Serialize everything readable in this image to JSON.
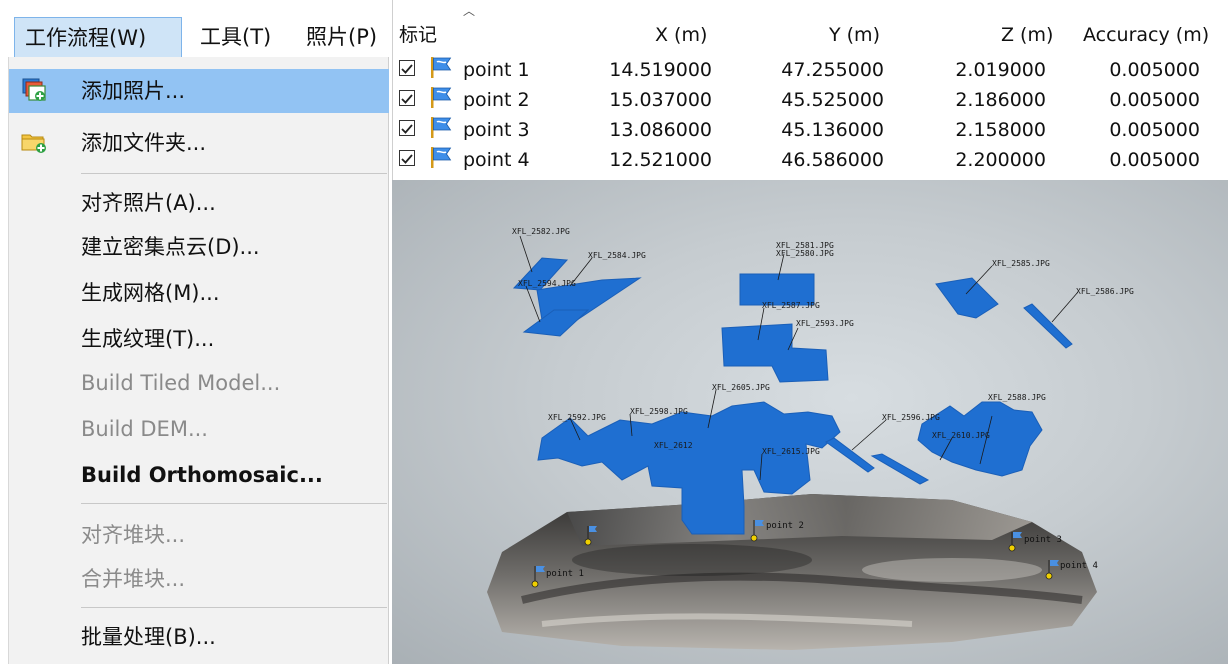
{
  "menubar": {
    "workflow": "工作流程(W)",
    "tools": "工具(T)",
    "photos": "照片(P)"
  },
  "workflow_menu": {
    "add_photos": "添加照片...",
    "add_folder": "添加文件夹...",
    "align_photos": "对齐照片(A)...",
    "build_dense_cloud": "建立密集点云(D)...",
    "build_mesh": "生成网格(M)...",
    "build_texture": "生成纹理(T)...",
    "build_tiled_model": "Build Tiled Model...",
    "build_dem": "Build DEM...",
    "build_orthomosaic": "Build Orthomosaic...",
    "align_chunks": "对齐堆块...",
    "merge_chunks": "合并堆块...",
    "batch_process": "批量处理(B)..."
  },
  "markers_table": {
    "columns": [
      "标记",
      "X (m)",
      "Y (m)",
      "Z (m)",
      "Accuracy (m)"
    ],
    "rows": [
      {
        "name": "point 1",
        "x": "14.519000",
        "y": "47.255000",
        "z": "2.019000",
        "accuracy": "0.005000"
      },
      {
        "name": "point 2",
        "x": "15.037000",
        "y": "45.525000",
        "z": "2.186000",
        "accuracy": "0.005000"
      },
      {
        "name": "point 3",
        "x": "13.086000",
        "y": "45.136000",
        "z": "2.158000",
        "accuracy": "0.005000"
      },
      {
        "name": "point 4",
        "x": "12.521000",
        "y": "46.586000",
        "z": "2.200000",
        "accuracy": "0.005000"
      }
    ]
  },
  "viewport": {
    "camera_labels": {
      "c2582": "XFL_2582.JPG",
      "c2584": "XFL_2584.JPG",
      "c2594": "XFL_2594.JPG",
      "c2581": "XFL_2581.JPG",
      "c2580": "XFL_2580.JPG",
      "c2587": "XFL_2587.JPG",
      "c2593": "XFL_2593.JPG",
      "c2585": "XFL_2585.JPG",
      "c2586": "XFL_2586.JPG",
      "c2592": "XFL_2592.JPG",
      "c2598": "XFL_2598.JPG",
      "c2596": "XFL_2596.JPG",
      "c2588": "XFL_2588.JPG",
      "c2610": "XFL_2610.JPG",
      "c2615": "XFL_2615.JPG",
      "c2605": "XFL_2605.JPG",
      "c2612": "XFL_2612"
    },
    "marker_labels": {
      "p1": "point 1",
      "p2": "point 2",
      "p3": "point 3",
      "p4": "point 4"
    }
  },
  "colors": {
    "camera_fill": "#1f6fd1",
    "highlight": "#92c3f3",
    "menu_active": "#cfe4f7",
    "marker": "#f0d000"
  }
}
